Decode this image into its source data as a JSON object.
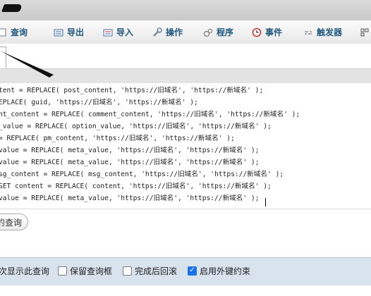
{
  "toolbar": {
    "tabs": [
      {
        "label": "查询",
        "icon": "query-icon"
      },
      {
        "label": "导出",
        "icon": "export-icon"
      },
      {
        "label": "导入",
        "icon": "import-icon"
      },
      {
        "label": "操作",
        "icon": "wrench-icon"
      },
      {
        "label": "程序",
        "icon": "routines-icon"
      },
      {
        "label": "事件",
        "icon": "clock-icon"
      },
      {
        "label": "触发器",
        "icon": "trigger-icon"
      }
    ]
  },
  "editor": {
    "lines": [
      "tent = REPLACE( post_content, 'https://旧域名', 'https://新域名' );",
      "EPLACE( guid, 'https://旧域名', 'https://新域名' );",
      "nt_content = REPLACE( comment_content, 'https://旧域名', 'https://新域名' );",
      "_value = REPLACE( option_value, 'https://旧域名', 'https://新域名' );",
      "= REPLACE( pm_content, 'https://旧域名', 'https://新域名' );",
      "value = REPLACE( meta_value, 'https://旧域名', 'https://新域名' );",
      "value = REPLACE( meta_value, 'https://旧域名', 'https://新域名' );",
      "sg_content = REPLACE( msg_content, 'https://旧域名', 'https://新域名' );",
      "SET content = REPLACE( content, 'https://旧域名', 'https://新域名' );",
      "value = REPLACE( meta_value, 'https://旧域名', 'https://新域名' );"
    ]
  },
  "query_button": {
    "label": "的查询"
  },
  "options": {
    "show_again": "次显示此查询",
    "keep_box": "保留查询框",
    "rollback": "完成后回滚",
    "foreign_keys": "启用外键约束",
    "foreign_keys_checked": true
  },
  "colors": {
    "tab_text": "#235a81",
    "checkbox_on": "#1a73e8",
    "options_bg": "#d9e3ee"
  }
}
